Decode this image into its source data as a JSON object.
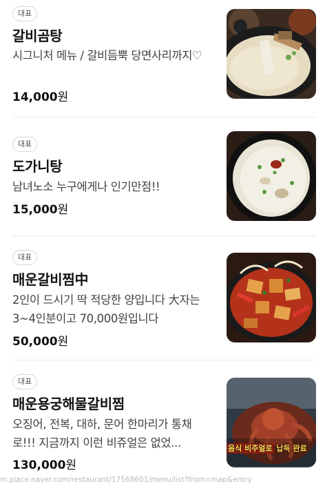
{
  "items": [
    {
      "badge": "대표",
      "name": "갈비곰탕",
      "desc": "시그니처 메뉴 / 갈비듬뿍 당면사리까지♡",
      "price_num": "14,000",
      "price_unit": "원",
      "image_icon": "galbi-gomtang-photo"
    },
    {
      "badge": "대표",
      "name": "도가니탕",
      "desc": "남녀노소 누구에게나 인기만점!!",
      "price_num": "15,000",
      "price_unit": "원",
      "image_icon": "dogani-tang-photo"
    },
    {
      "badge": "대표",
      "name": "매운갈비찜中",
      "desc": "2인이 드시기 딱 적당한 양입니다 大자는 3~4인분이고 70,000원입니다",
      "price_num": "50,000",
      "price_unit": "원",
      "image_icon": "spicy-galbi-jjim-photo"
    },
    {
      "badge": "대표",
      "name": "매운용궁해물갈비찜",
      "desc": "오징어, 전복, 대하, 문어 한마리가 통채로!!! 지금까지 이런 비쥬얼은 없었...",
      "price_num": "130,000",
      "price_unit": "원",
      "image_icon": "seafood-galbi-jjim-photo",
      "image_caption_1": "음식 비주얼로",
      "image_caption_2": "납득 완료"
    }
  ],
  "watermark": "m.place.naver.com/restaurant/17568601/menu/list?from=map&entry"
}
